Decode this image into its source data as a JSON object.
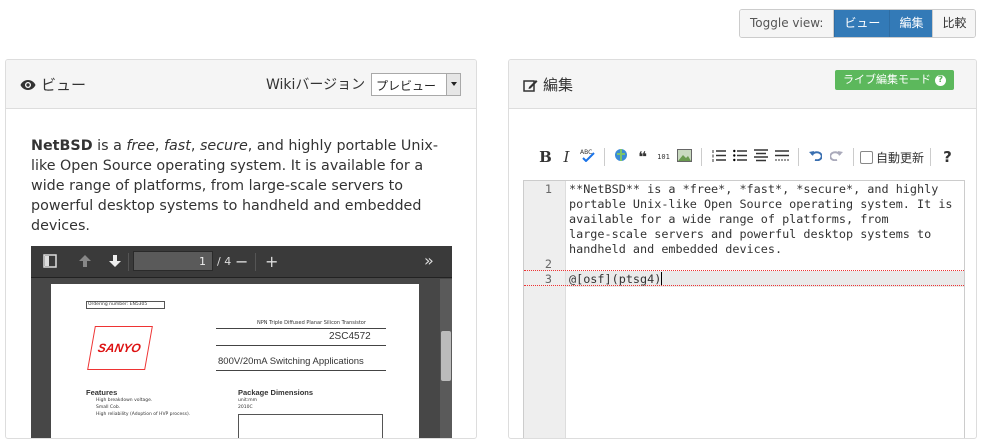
{
  "toggle": {
    "label": "Toggle view:",
    "view": "ビュー",
    "edit": "編集",
    "compare": "比較"
  },
  "left_panel": {
    "title": "ビュー",
    "wiki_version_label": "Wikiバージョン",
    "wiki_version_value": "プレビュー",
    "article": {
      "strong": "NetBSD",
      "is_a": " is a ",
      "free": "free",
      "comma1": ", ",
      "fast": "fast",
      "comma2": ", ",
      "secure": "secure",
      "rest": ", and highly portable Unix-like Open Source operating system. It is available for a wide range of platforms, from large-scale servers to powerful desktop systems to handheld and embedded devices."
    },
    "pdf": {
      "page": "1",
      "of": "/ 4",
      "doc": {
        "ordering": "Ordering number: EN5305",
        "subtitle": "NPN Triple Diffused Planar Silicon Transistor",
        "brand": "SANYO",
        "part": "2SC4572",
        "application": "800V/20mA Switching Applications",
        "features": "Features",
        "feat1": "High breakdown voltage.",
        "feat2": "Small Cob.",
        "feat3": "High reliability (Adoption of HVP process).",
        "package": "Package Dimensions",
        "unit": "unit:mm",
        "pkg": "2010C"
      }
    }
  },
  "right_panel": {
    "title": "編集",
    "live_button": "ライブ編集モード",
    "toolbar": {
      "bold": "B",
      "italic": "I",
      "quote": "❝",
      "code": "101",
      "auto_update": "自動更新",
      "help": "?"
    },
    "editor": {
      "line_numbers": [
        "1",
        "2",
        "3"
      ],
      "lines": [
        "**NetBSD** is a *free*, *fast*, *secure*, and highly",
        "portable Unix-like Open Source operating system. It is",
        "available for a wide range of platforms, from",
        "large-scale servers and powerful desktop systems to",
        "handheld and embedded devices.",
        "@[osf](ptsg4)"
      ]
    }
  },
  "colors": {
    "primary": "#337ab7",
    "success": "#5cb85c"
  }
}
